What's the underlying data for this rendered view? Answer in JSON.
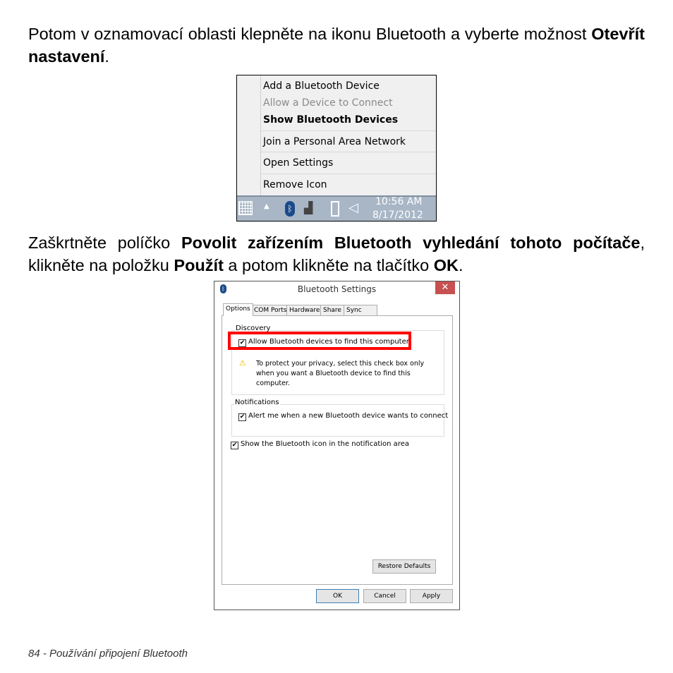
{
  "paragraph1": {
    "text_before": "Potom v oznamovací oblasti klepněte na ikonu Bluetooth a vyberte možnost ",
    "bold": "Otevřít nastavení",
    "text_after": "."
  },
  "context_menu": {
    "items": [
      {
        "label": "Add a Bluetooth Device",
        "state": "normal"
      },
      {
        "label": "Allow a Device to Connect",
        "state": "disabled"
      },
      {
        "label": "Show Bluetooth Devices",
        "state": "bold"
      },
      {
        "label": "Join a Personal Area Network",
        "state": "normal"
      },
      {
        "label": "Open Settings",
        "state": "normal"
      },
      {
        "label": "Remove Icon",
        "state": "normal"
      }
    ],
    "taskbar": {
      "time": "10:56 AM",
      "date": "8/17/2012"
    }
  },
  "paragraph2": {
    "t1": "Zaškrtněte políčko ",
    "b1": "Povolit zařízením Bluetooth vyhledání tohoto počítače",
    "t2": ", klikněte na položku ",
    "b2": "Použít",
    "t3": " a potom klikněte na tlačítko ",
    "b3": "OK",
    "t4": "."
  },
  "dialog": {
    "title": "Bluetooth Settings",
    "close": "✕",
    "tabs": [
      "Options",
      "COM Ports",
      "Hardware",
      "Share",
      "Sync"
    ],
    "discovery": {
      "label": "Discovery",
      "checkbox": "Allow Bluetooth devices to find this computer",
      "checked": true,
      "warning": "To protect your privacy, select this check box only when you want a Bluetooth device to find this computer."
    },
    "notifications": {
      "label": "Notifications",
      "checkbox": "Alert me when a new Bluetooth device wants to connect",
      "checked": true
    },
    "show_icon": {
      "checkbox": "Show the Bluetooth icon in the notification area",
      "checked": true
    },
    "restore": "Restore Defaults",
    "ok": "OK",
    "cancel": "Cancel",
    "apply": "Apply",
    "highlight_color": "#ff0000"
  },
  "footer": "84 - Používání připojení Bluetooth"
}
